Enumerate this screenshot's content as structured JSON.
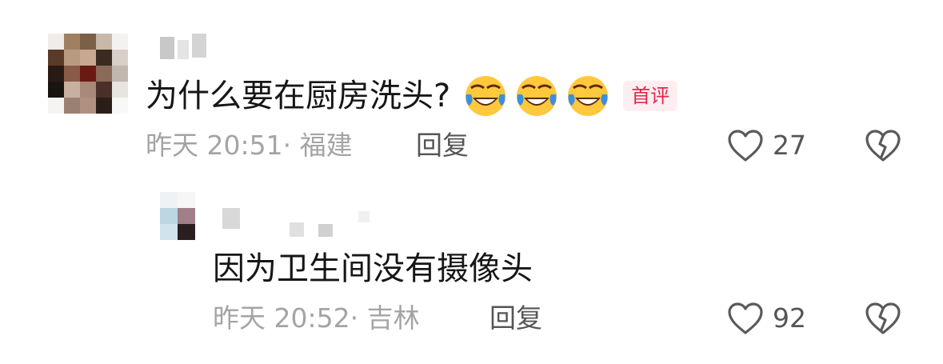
{
  "colors": {
    "badge_bg": "#ffeef1",
    "badge_text": "#e6254c",
    "meta_text": "#a4a4a4",
    "action_text": "#555555",
    "icon_stroke": "#5a5a5a",
    "emoji_face": "#ffc83d",
    "emoji_tear": "#3b8fe0"
  },
  "comments": [
    {
      "username": "",
      "avatar": "avatar-blurred",
      "text": "为什么要在厨房洗头?",
      "emojis": [
        "laugh-cry-emoji",
        "laugh-cry-emoji",
        "laugh-cry-emoji"
      ],
      "badge": "首评",
      "meta": "昨天 20:51· 福建",
      "reply_label": "回复",
      "likes": "27",
      "like_icon": "heart-outline-icon",
      "dislike_icon": "broken-heart-icon"
    }
  ],
  "replies": [
    {
      "username": "",
      "avatar": "avatar-blurred",
      "text": "因为卫生间没有摄像头",
      "meta": "昨天 20:52· 吉林",
      "reply_label": "回复",
      "likes": "92",
      "like_icon": "heart-outline-icon",
      "dislike_icon": "broken-heart-icon"
    }
  ]
}
